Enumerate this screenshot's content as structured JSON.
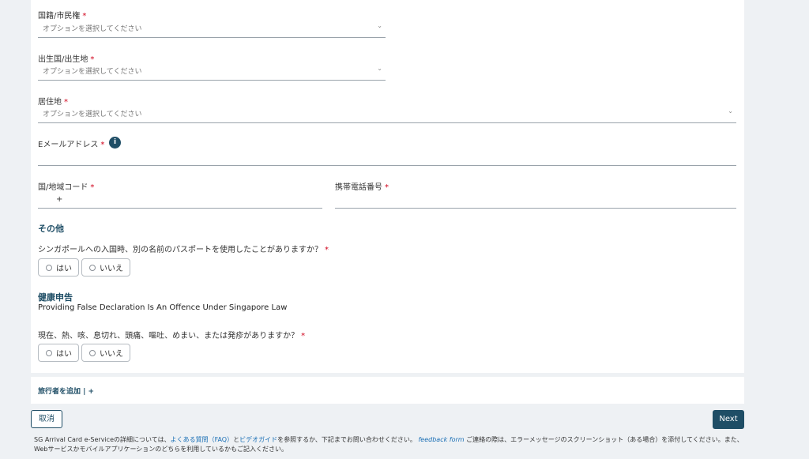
{
  "form": {
    "nationality": {
      "label": "国籍/市民権",
      "required": "*",
      "placeholder": "オプションを選択してください"
    },
    "birth_country": {
      "label": "出生国/出生地",
      "required": "*",
      "placeholder": "オプションを選択してください"
    },
    "residence": {
      "label": "居住地",
      "required": "*",
      "placeholder": "オプションを選択してください"
    },
    "email": {
      "label": "Eメールアドレス",
      "required": "*",
      "info_icon": "i"
    },
    "country_code": {
      "label": "国/地域コード",
      "required": "*",
      "prefix": "+"
    },
    "mobile": {
      "label": "携帯電話番号",
      "required": "*"
    }
  },
  "other_section": {
    "title": "その他",
    "question": "シンガポールへの入国時、別の名前のパスポートを使用したことがありますか？",
    "required": "*",
    "options": [
      "はい",
      "いいえ"
    ]
  },
  "health_section": {
    "title": "健康申告",
    "subtitle": "Providing False Declaration Is An Offence Under Singapore Law",
    "question": "現在、熱、咳、息切れ、頭痛、嘔吐、めまい、または発疹がありますか？",
    "required": "*",
    "options": [
      "はい",
      "いいえ"
    ]
  },
  "add_traveler": "旅行者を追加 | +",
  "buttons": {
    "cancel": "取消",
    "next": "Next"
  },
  "footer": {
    "t1": "SG Arrival Card e-Serviceの詳細については、",
    "faq_link": "よくある質問（FAQ）",
    "t2": "と",
    "video_link": "ビデオガイド",
    "t3": "を参照するか、下記までお問い合わせください。",
    "feedback_link": "feedback form",
    "t4": " ご連絡の際は、エラーメッセージのスクリーンショット（ある場合）を添付してください。また、",
    "t5": "Webサービスかモバイルアプリケーションのどちらを利用しているかもご記入ください。"
  },
  "colors": {
    "accent": "#1f4e66",
    "required": "#d0021b",
    "link": "#1a6fb5"
  }
}
